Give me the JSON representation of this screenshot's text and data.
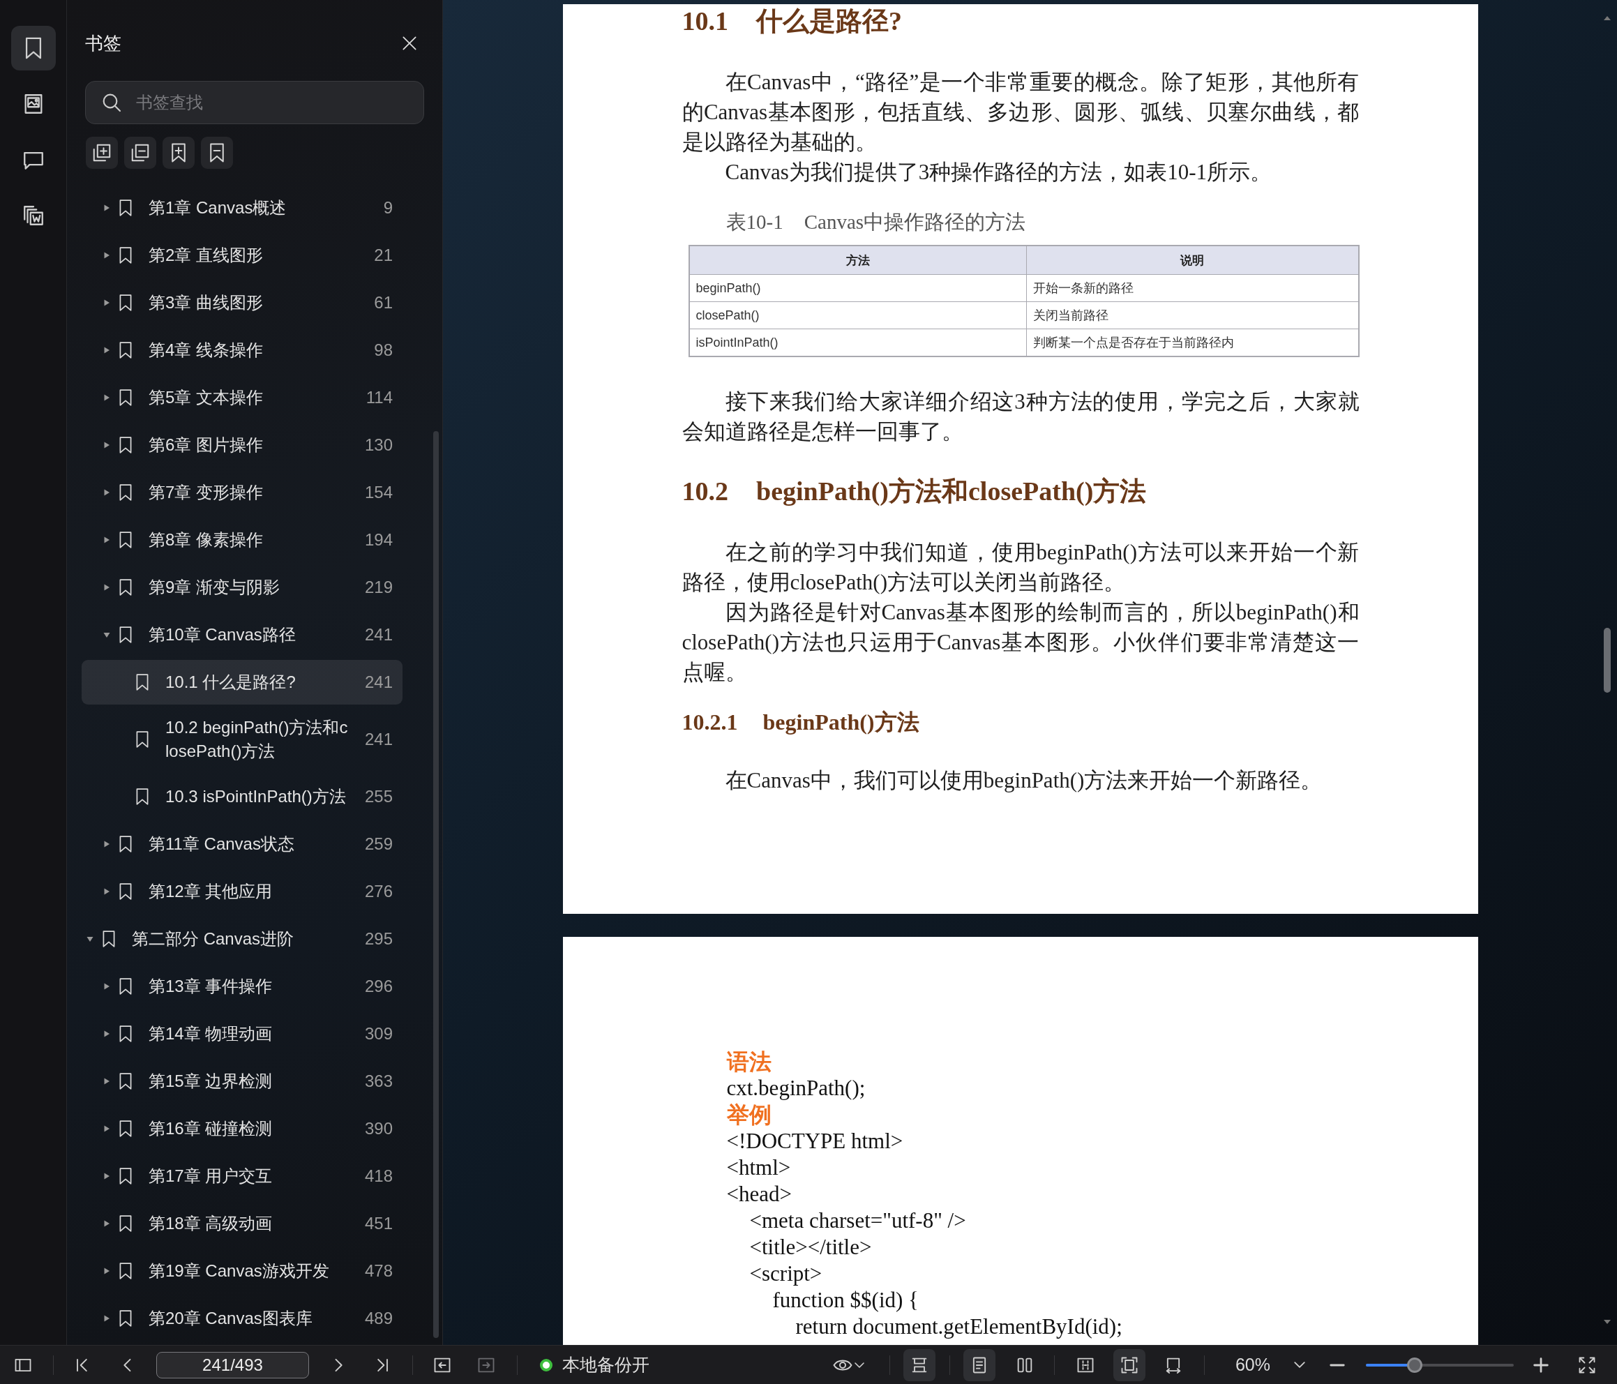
{
  "rail_tabs": [
    {
      "selected": true
    },
    {
      "selected": false
    },
    {
      "selected": false
    },
    {
      "selected": false
    }
  ],
  "bookmarks_panel": {
    "title": "书签",
    "search": {
      "placeholder": "书签查找"
    },
    "tree": {
      "items_of_previous_part": [
        {
          "title": "第1章 Canvas概述",
          "page": "9",
          "expanded": false,
          "selected": false
        },
        {
          "title": "第2章 直线图形",
          "page": "21",
          "expanded": false,
          "selected": false
        },
        {
          "title": "第3章 曲线图形",
          "page": "61",
          "expanded": false,
          "selected": false
        },
        {
          "title": "第4章 线条操作",
          "page": "98",
          "expanded": false,
          "selected": false
        },
        {
          "title": "第5章 文本操作",
          "page": "114",
          "expanded": false,
          "selected": false
        },
        {
          "title": "第6章 图片操作",
          "page": "130",
          "expanded": false,
          "selected": false
        },
        {
          "title": "第7章 变形操作",
          "page": "154",
          "expanded": false,
          "selected": false
        },
        {
          "title": "第8章 像素操作",
          "page": "194",
          "expanded": false,
          "selected": false
        },
        {
          "title": "第9章 渐变与阴影",
          "page": "219",
          "expanded": false,
          "selected": false
        },
        {
          "title": "第10章 Canvas路径",
          "page": "241",
          "expanded": true,
          "selected": false,
          "children": [
            {
              "title": "10.1 什么是路径?",
              "page": "241",
              "selected": true
            },
            {
              "title": "10.2 beginPath()方法和closePath()方法",
              "page": "241",
              "selected": false
            },
            {
              "title": "10.3 isPointInPath()方法",
              "page": "255",
              "selected": false
            }
          ]
        },
        {
          "title": "第11章 Canvas状态",
          "page": "259",
          "expanded": false,
          "selected": false
        },
        {
          "title": "第12章 其他应用",
          "page": "276",
          "expanded": false,
          "selected": false
        }
      ],
      "parts": [
        {
          "title": "第二部分 Canvas进阶",
          "page": "295",
          "expanded": true,
          "selected": false,
          "children": [
            {
              "title": "第13章 事件操作",
              "page": "296",
              "expanded": false,
              "selected": false
            },
            {
              "title": "第14章 物理动画",
              "page": "309",
              "expanded": false,
              "selected": false
            },
            {
              "title": "第15章 边界检测",
              "page": "363",
              "expanded": false,
              "selected": false
            },
            {
              "title": "第16章 碰撞检测",
              "page": "390",
              "expanded": false,
              "selected": false
            },
            {
              "title": "第17章 用户交互",
              "page": "418",
              "expanded": false,
              "selected": false
            },
            {
              "title": "第18章 高级动画",
              "page": "451",
              "expanded": false,
              "selected": false
            },
            {
              "title": "第19章 Canvas游戏开发",
              "page": "478",
              "expanded": false,
              "selected": false
            },
            {
              "title": "第20章 Canvas图表库",
              "page": "489",
              "expanded": false,
              "selected": false
            }
          ]
        }
      ]
    }
  },
  "pages": [
    {
      "blocks": [
        {
          "kind": "heading",
          "number": "10.1",
          "title": "什么是路径?"
        },
        {
          "kind": "text",
          "paragraphs": [
            "在Canvas中，“路径”是一个非常重要的概念。除了矩形，其他所有的Canvas基本图形，包括直线、多边形、圆形、弧线、贝塞尔曲线，都是以路径为基础的。",
            "Canvas为我们提供了3种操作路径的方法，如表10-1所示。"
          ]
        },
        {
          "kind": "caption",
          "number": "表10-1",
          "title": "Canvas中操作路径的方法"
        },
        {
          "kind": "table",
          "columns": [
            "方法",
            "说明"
          ],
          "rows": [
            [
              "beginPath()",
              "开始一条新的路径"
            ],
            [
              "closePath()",
              "关闭当前路径"
            ],
            [
              "isPointInPath()",
              "判断某一个点是否存在于当前路径内"
            ]
          ]
        },
        {
          "kind": "text",
          "paragraphs": [
            "接下来我们给大家详细介绍这3种方法的使用，学完之后，大家就会知道路径是怎样一回事了。"
          ]
        },
        {
          "kind": "heading",
          "number": "10.2",
          "title": "beginPath()方法和closePath()方法"
        },
        {
          "kind": "text",
          "paragraphs": [
            "在之前的学习中我们知道，使用beginPath()方法可以来开始一个新路径，使用closePath()方法可以关闭当前路径。",
            "因为路径是针对Canvas基本图形的绘制而言的，所以beginPath()和closePath()方法也只运用于Canvas基本图形。小伙伴们要非常清楚这一点喔。"
          ]
        },
        {
          "kind": "subheading",
          "number": "10.2.1",
          "title": "beginPath()方法"
        },
        {
          "kind": "text",
          "paragraphs": [
            "在Canvas中，我们可以使用beginPath()方法来开始一个新路径。"
          ]
        }
      ]
    },
    {
      "blocks": [
        {
          "kind": "label",
          "text": "语法"
        },
        {
          "kind": "code",
          "lines": [
            {
              "text": "cxt.beginPath();"
            }
          ]
        },
        {
          "kind": "label",
          "text": "举例"
        },
        {
          "kind": "code",
          "lines": [
            {
              "text": "<!DOCTYPE html>"
            },
            {
              "text": "<html>"
            },
            {
              "text": "<head>",
              "children": [
                {
                  "text": "<meta charset=\"utf-8\" />"
                },
                {
                  "text": "<title></title>"
                },
                {
                  "text": "<script>",
                  "children": [
                    {
                      "text": "function $$(id) {",
                      "children": [
                        {
                          "text": "return document.getElementById(id);"
                        }
                      ]
                    }
                  ]
                }
              ]
            }
          ]
        }
      ]
    }
  ],
  "toolbar": {
    "page_field": {
      "value": "241/493"
    },
    "back_button": {
      "disabled": false
    },
    "forward_button": {
      "disabled": true
    },
    "backup": {
      "label": "本地备份开",
      "on": true
    },
    "scroll_button": {
      "selected": true
    },
    "page_layout_buttons": [
      {
        "selected": true
      },
      {
        "selected": false
      }
    ],
    "fit_buttons": [
      {
        "selected": false
      },
      {
        "selected": true
      },
      {
        "selected": false
      }
    ],
    "zoom": {
      "label": "60%",
      "level": 0.33
    }
  }
}
